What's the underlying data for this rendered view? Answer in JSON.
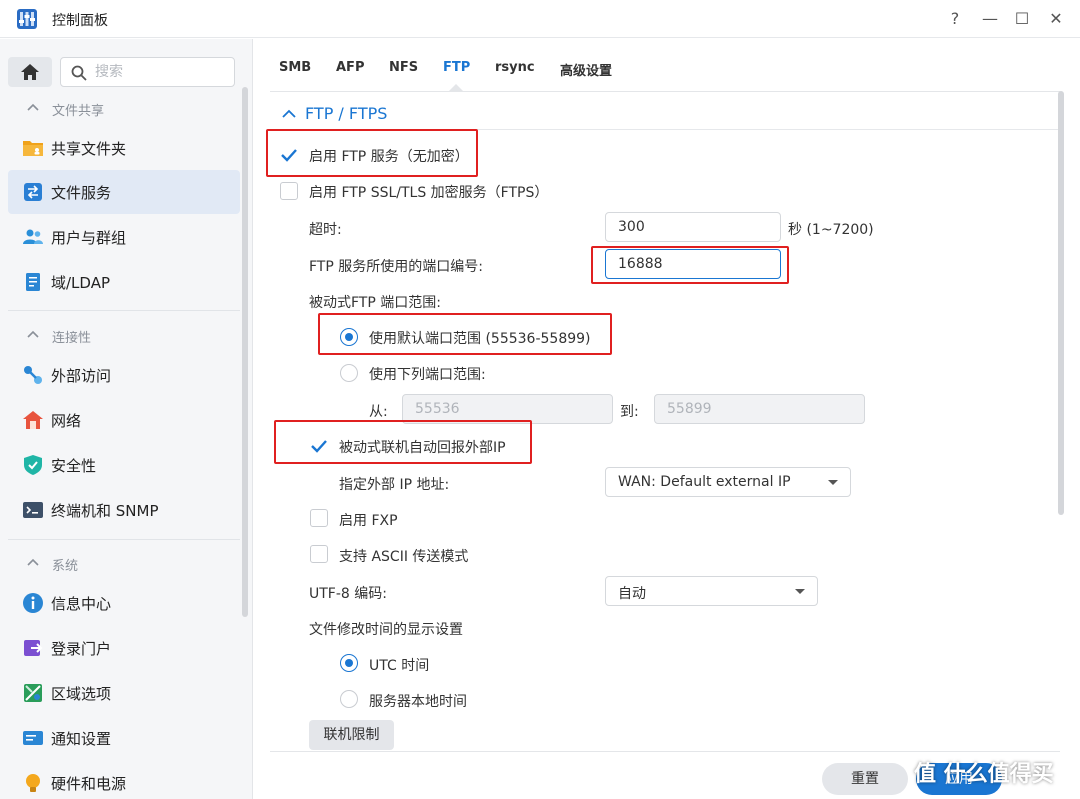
{
  "window": {
    "title": "控制面板",
    "help_label": "?",
    "min_label": "—",
    "max_label": "☐",
    "close_label": "✕"
  },
  "sidebar": {
    "search_placeholder": "搜索",
    "sections": [
      {
        "title": "文件共享",
        "items": [
          {
            "label": "共享文件夹",
            "icon": "folder-icon"
          },
          {
            "label": "文件服务",
            "icon": "file-services-icon",
            "active": true
          },
          {
            "label": "用户与群组",
            "icon": "users-icon"
          },
          {
            "label": "域/LDAP",
            "icon": "domain-icon"
          }
        ]
      },
      {
        "title": "连接性",
        "items": [
          {
            "label": "外部访问",
            "icon": "external-access-icon"
          },
          {
            "label": "网络",
            "icon": "network-icon"
          },
          {
            "label": "安全性",
            "icon": "shield-icon"
          },
          {
            "label": "终端机和 SNMP",
            "icon": "terminal-icon"
          }
        ]
      },
      {
        "title": "系统",
        "items": [
          {
            "label": "信息中心",
            "icon": "info-icon"
          },
          {
            "label": "登录门户",
            "icon": "login-portal-icon"
          },
          {
            "label": "区域选项",
            "icon": "region-icon"
          },
          {
            "label": "通知设置",
            "icon": "notification-icon"
          },
          {
            "label": "硬件和电源",
            "icon": "bulb-icon"
          }
        ]
      }
    ]
  },
  "tabs": [
    {
      "label": "SMB"
    },
    {
      "label": "AFP"
    },
    {
      "label": "NFS"
    },
    {
      "label": "FTP",
      "active": true
    },
    {
      "label": "rsync"
    },
    {
      "label": "高级设置"
    }
  ],
  "ftp": {
    "section_title": "FTP / FTPS",
    "enable_ftp": "启用 FTP 服务（无加密）",
    "enable_ftps": "启用 FTP SSL/TLS 加密服务（FTPS）",
    "timeout_label": "超时:",
    "timeout_value": "300",
    "timeout_range": "秒 (1~7200)",
    "port_label": "FTP 服务所使用的端口编号:",
    "port_value": "16888",
    "passive_label": "被动式FTP 端口范围:",
    "passive_default": "使用默认端口范围 (55536-55899)",
    "passive_custom": "使用下列端口范围:",
    "from_label": "从:",
    "from_value": "55536",
    "to_label": "到:",
    "to_value": "55899",
    "report_ip": "被动式联机自动回报外部IP",
    "external_ip_label": "指定外部 IP 地址:",
    "external_ip_value": "WAN: Default external IP",
    "enable_fxp": "启用 FXP",
    "ascii_mode": "支持 ASCII 传送模式",
    "utf8_label": "UTF-8 编码:",
    "utf8_value": "自动",
    "time_display_label": "文件修改时间的显示设置",
    "utc_time": "UTC 时间",
    "local_time": "服务器本地时间",
    "conn_limit": "联机限制"
  },
  "footer": {
    "reset_label": "重置",
    "apply_label": "应用"
  },
  "watermark": "值 什么值得买",
  "colors": {
    "accent": "#1a76d2",
    "highlight": "#e02020"
  }
}
